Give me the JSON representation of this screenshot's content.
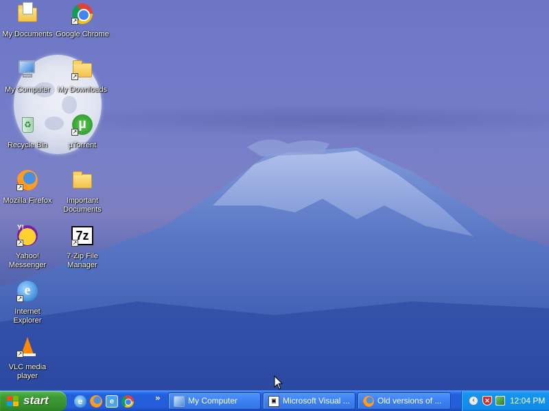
{
  "desktop": {
    "icons": [
      {
        "label": "My Documents",
        "icon": "my-documents-icon",
        "shortcut": false
      },
      {
        "label": "Google Chrome",
        "icon": "google-chrome-icon",
        "shortcut": true
      },
      {
        "label": "My Computer",
        "icon": "my-computer-icon",
        "shortcut": false
      },
      {
        "label": "My Downloads",
        "icon": "folder-icon",
        "shortcut": true
      },
      {
        "label": "Recycle Bin",
        "icon": "recycle-bin-icon",
        "shortcut": false
      },
      {
        "label": "µTorrent",
        "icon": "utorrent-icon",
        "shortcut": true
      },
      {
        "label": "Mozilla Firefox",
        "icon": "firefox-icon",
        "shortcut": true
      },
      {
        "label": "Important Documents",
        "icon": "folder-icon",
        "shortcut": false
      },
      {
        "label": "Yahoo! Messenger",
        "icon": "yahoo-messenger-icon",
        "shortcut": true
      },
      {
        "label": "7-Zip File Manager",
        "icon": "7zip-icon",
        "shortcut": true
      },
      {
        "label": "Internet Explorer",
        "icon": "internet-explorer-icon",
        "shortcut": true
      },
      {
        "label": "VLC media player",
        "icon": "vlc-icon",
        "shortcut": true
      }
    ],
    "wallpaper": "mountain-with-moon"
  },
  "taskbar": {
    "start_label": "start",
    "quick_launch": [
      "internet-explorer-icon",
      "firefox-icon",
      "internet-explorer-icon",
      "google-chrome-icon"
    ],
    "quick_launch_more": "»",
    "tasks": [
      {
        "label": "My Computer",
        "icon": "my-computer-icon"
      },
      {
        "label": "Microsoft Visual ...",
        "icon": "visual-studio-icon"
      },
      {
        "label": "Old versions of ...",
        "icon": "firefox-icon"
      }
    ],
    "tray": {
      "icons": [
        "show-hidden-icons-arrow-icon",
        "security-shield-icon",
        "network-icon"
      ],
      "clock": "12:04 PM"
    }
  },
  "colors": {
    "taskbar_blue": "#245edb",
    "start_green": "#3c9a33",
    "tray_blue": "#0f8bea",
    "sky_blue": "#737dc8"
  }
}
